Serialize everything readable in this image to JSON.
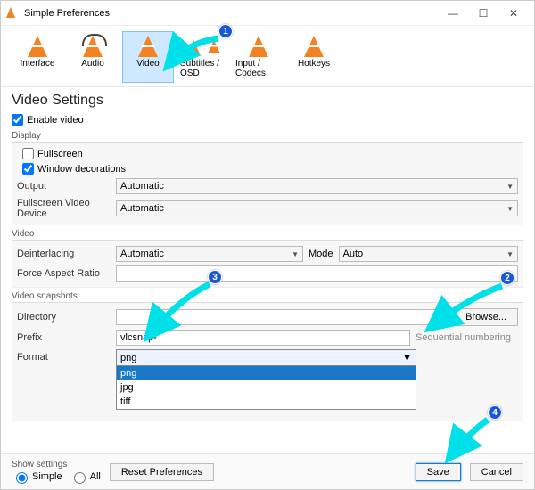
{
  "window": {
    "title": "Simple Preferences"
  },
  "titlebar_buttons": {
    "min": "—",
    "max": "☐",
    "close": "✕"
  },
  "tabs": [
    {
      "label": "Interface"
    },
    {
      "label": "Audio"
    },
    {
      "label": "Video"
    },
    {
      "label": "Subtitles / OSD"
    },
    {
      "label": "Input / Codecs"
    },
    {
      "label": "Hotkeys"
    }
  ],
  "section_title": "Video Settings",
  "enable_video": {
    "label": "Enable video",
    "checked": true
  },
  "display": {
    "group": "Display",
    "fullscreen": {
      "label": "Fullscreen",
      "checked": false
    },
    "decorations": {
      "label": "Window decorations",
      "checked": true
    },
    "output": {
      "label": "Output",
      "value": "Automatic"
    },
    "fsdevice": {
      "label": "Fullscreen Video Device",
      "value": "Automatic"
    }
  },
  "video": {
    "group": "Video",
    "deint": {
      "label": "Deinterlacing",
      "value": "Automatic",
      "mode_label": "Mode",
      "mode_value": "Auto"
    },
    "aspect": {
      "label": "Force Aspect Ratio",
      "value": ""
    }
  },
  "snapshots": {
    "group": "Video snapshots",
    "directory": {
      "label": "Directory",
      "value": "",
      "browse": "Browse..."
    },
    "prefix": {
      "label": "Prefix",
      "value": "vlcsnap-",
      "seq": "Sequential numbering"
    },
    "format": {
      "label": "Format",
      "value": "png",
      "options": [
        "png",
        "jpg",
        "tiff"
      ]
    }
  },
  "footer": {
    "show_settings": "Show settings",
    "simple": "Simple",
    "all": "All",
    "reset": "Reset Preferences",
    "save": "Save",
    "cancel": "Cancel"
  },
  "badges": [
    "1",
    "2",
    "3",
    "4"
  ]
}
